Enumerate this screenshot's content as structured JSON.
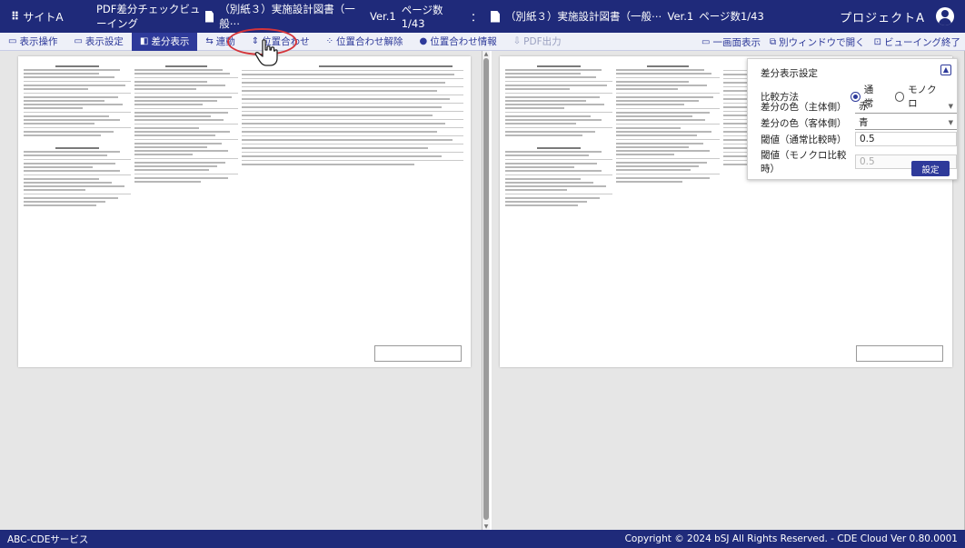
{
  "header": {
    "site_label": "サイトA",
    "app_name": "PDF差分チェックビューイング",
    "doc_left": "（別紙３）実施設計図書（一般⋯",
    "doc_left_version": "Ver.1",
    "doc_left_pages": "ページ数1/43",
    "separator": "：",
    "doc_right": "（別紙３）実施設計図書（一般⋯",
    "doc_right_version": "Ver.1",
    "doc_right_pages": "ページ数1/43",
    "project": "プロジェクトA"
  },
  "toolbar": {
    "items": [
      {
        "icon": "▭",
        "label": "表示操作"
      },
      {
        "icon": "▭",
        "label": "表示設定"
      },
      {
        "icon": "◧",
        "label": "差分表示"
      },
      {
        "icon": "⇆",
        "label": "連動"
      },
      {
        "icon": "⇕",
        "label": "位置合わせ"
      },
      {
        "icon": "⁘",
        "label": "位置合わせ解除"
      },
      {
        "icon": "●",
        "label": "位置合わせ情報"
      },
      {
        "icon": "⇩",
        "label": "PDF出力"
      }
    ],
    "right_items": [
      {
        "icon": "▭",
        "label": "一画面表示"
      },
      {
        "icon": "⧉",
        "label": "別ウィンドウで開く"
      },
      {
        "icon": "⊡",
        "label": "ビューイング終了"
      }
    ]
  },
  "diff_settings": {
    "title": "差分表示設定",
    "compare_label": "比較方法",
    "compare_options": [
      "通常",
      "モノクロ"
    ],
    "compare_selected": "通常",
    "main_color_label": "差分の色（主体側）",
    "main_color": "赤",
    "other_color_label": "差分の色（客体側）",
    "other_color": "青",
    "threshold_normal_label": "閾値（通常比較時）",
    "threshold_normal": "0.5",
    "threshold_mono_label": "閾値（モノクロ比較時）",
    "threshold_mono": "0.5",
    "apply_label": "設定"
  },
  "footer": {
    "service": "ABC-CDEサービス",
    "copyright": "Copyright © 2024 bSJ All Rights Reserved. - CDE Cloud Ver 0.80.0001"
  },
  "colors": {
    "header_bg": "#1f2a7a",
    "accent": "#2e3a9a",
    "highlight": "#d4343a"
  }
}
